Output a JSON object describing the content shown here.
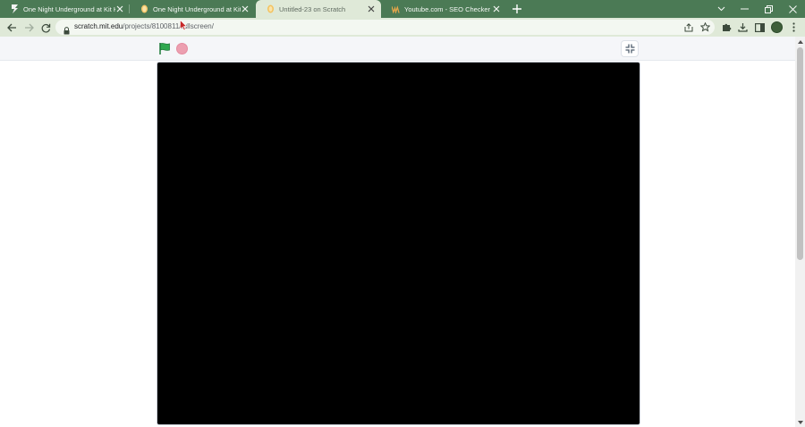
{
  "browser": {
    "tabs": [
      {
        "title": "One Night Underground at Kit K...",
        "favicon": "lightning-bolt-icon",
        "active": false
      },
      {
        "title": "One Night Underground at Kit K...",
        "favicon": "scratch-cat-icon",
        "active": false
      },
      {
        "title": "Untitled-23 on Scratch",
        "favicon": "scratch-cat-icon",
        "active": true
      },
      {
        "title": "Youtube.com - SEO Checker - W...",
        "favicon": "website-checker-icon",
        "active": false
      }
    ],
    "address": {
      "host": "scratch.mit.edu",
      "path": "/projects/810081",
      "path_tail": "1/fullscreen/"
    }
  },
  "colors": {
    "tabstrip": "#4b7a55",
    "toolbar": "#dfe9d8",
    "stage": "#000000",
    "stop": "#ec9fb0",
    "flag": "#2fa84f"
  },
  "player": {
    "controls": [
      "green-flag-icon",
      "stop-icon",
      "exit-fullscreen-icon"
    ]
  }
}
